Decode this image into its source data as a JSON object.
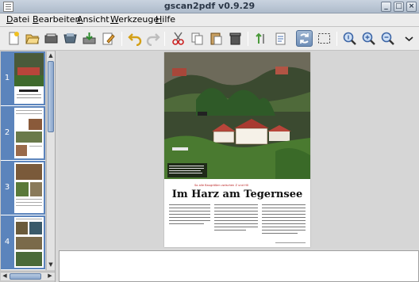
{
  "window": {
    "title": "gscan2pdf v0.9.29"
  },
  "menu": [
    "Datei",
    "Bearbeiten",
    "Ansicht",
    "Werkzeuge",
    "Hilfe"
  ],
  "toolbar": {
    "icons": [
      "new-icon",
      "open-icon",
      "scan-icon",
      "save-icon",
      "email-icon",
      "edit-icon",
      "undo-icon",
      "redo-icon",
      "cut-icon",
      "copy-icon",
      "paste-icon",
      "delete-icon",
      "renumber-icon",
      "properties-icon",
      "drag-icon",
      "select-icon",
      "zoom-100-icon",
      "zoom-in-icon",
      "zoom-out-icon",
      "more-icon"
    ]
  },
  "thumbnails": {
    "pages": [
      "1",
      "2",
      "3",
      "4"
    ]
  },
  "document": {
    "headline": "Im Harz am Tegernsee",
    "kicker": "So alle Baugrößen zwischen Z und H0"
  }
}
